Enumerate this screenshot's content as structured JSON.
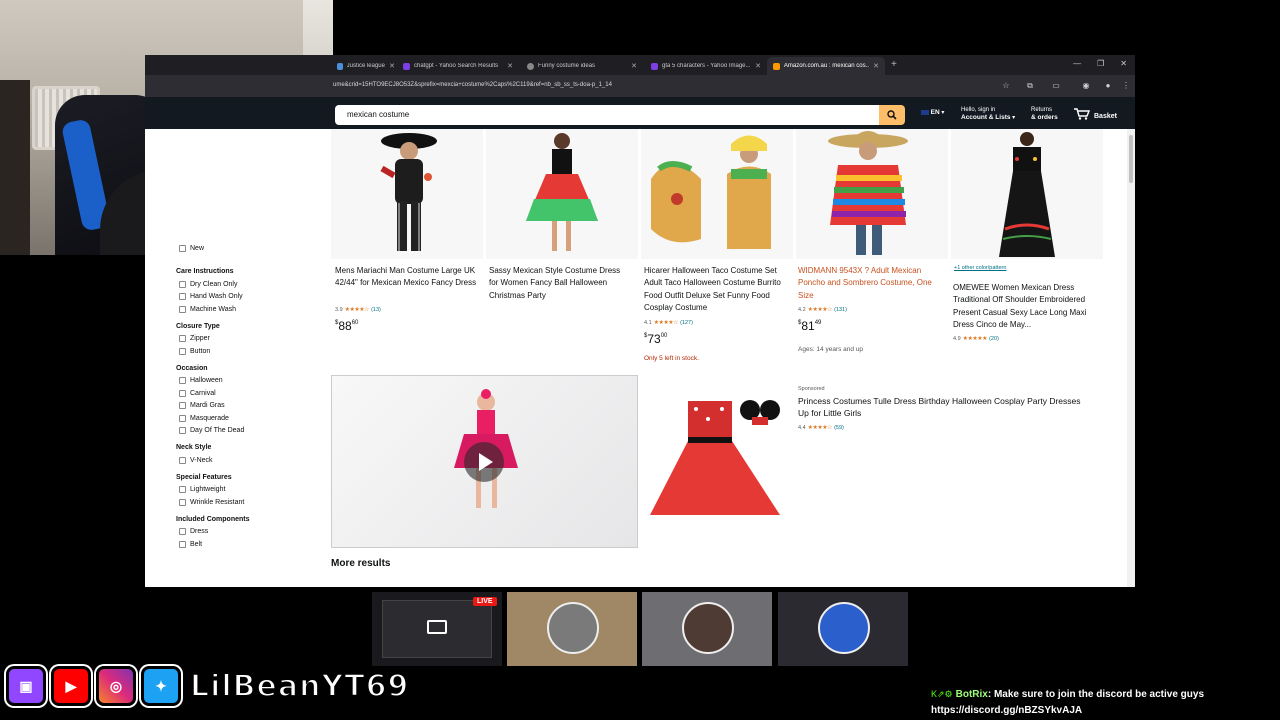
{
  "browser": {
    "tabs": [
      {
        "label": "Justice league c...",
        "favicon_color": "#4a90d9",
        "active": false
      },
      {
        "label": "chatgpt - Yahoo Search Results",
        "favicon_color": "#7b3fe4",
        "active": false
      },
      {
        "label": "Funny costume ideas",
        "favicon_color": "#888888",
        "active": false
      },
      {
        "label": "gta 5 characters - Yahoo Image...",
        "favicon_color": "#7b3fe4",
        "active": false
      },
      {
        "label": "Amazon.com.au : mexican cos...",
        "favicon_color": "#ff9900",
        "active": true
      }
    ],
    "url": "ume&crid=15HTO9ECJ8O53Z&sprefix=mexcia+costume%2Caps%2C119&ref=nb_sb_ss_ts-doa-p_1_14"
  },
  "amazon": {
    "search_value": "mexican costume",
    "language": "EN",
    "account_line1": "Hello, sign in",
    "account_line2": "Account & Lists",
    "returns_line1": "Returns",
    "returns_line2": "& orders",
    "basket_label": "Basket",
    "basket_count": "0",
    "accent": "#febd69"
  },
  "sidebar": {
    "partial_item": "New",
    "groups": [
      {
        "heading": "Care Instructions",
        "options": [
          "Dry Clean Only",
          "Hand Wash Only",
          "Machine Wash"
        ]
      },
      {
        "heading": "Closure Type",
        "options": [
          "Zipper",
          "Button"
        ]
      },
      {
        "heading": "Occasion",
        "options": [
          "Halloween",
          "Carnival",
          "Mardi Gras",
          "Masquerade",
          "Day Of The Dead"
        ]
      },
      {
        "heading": "Neck Style",
        "options": [
          "V-Neck"
        ]
      },
      {
        "heading": "Special Features",
        "options": [
          "Lightweight",
          "Wrinkle Resistant"
        ]
      },
      {
        "heading": "Included Components",
        "options": [
          "Dress",
          "Belt"
        ]
      }
    ]
  },
  "products": [
    {
      "title": "Mens Mariachi Man Costume Large UK 42/44\" for Mexican Mexico Fancy Dress",
      "rating": "3.9",
      "stars": "★★★★☆",
      "reviews": "(13)",
      "price_whole": "88",
      "price_frac": "60"
    },
    {
      "title": "Sassy Mexican Style Costume Dress for Women Fancy Ball Halloween Christmas Party",
      "rating": "",
      "stars": "",
      "reviews": "",
      "price_whole": "",
      "price_frac": ""
    },
    {
      "title": "Hicarer Halloween Taco Costume Set Adult Taco Halloween Costume Burrito Food Outfit Deluxe Set Funny Food Cosplay Costume",
      "rating": "4.1",
      "stars": "★★★★☆",
      "reviews": "(127)",
      "price_whole": "73",
      "price_frac": "00",
      "stock": "Only 5 left in stock."
    },
    {
      "title": "WIDMANN 9543X ? Adult Mexican Poncho and Sombrero Costume, One Size",
      "rating": "4.2",
      "stars": "★★★★☆",
      "reviews": "(131)",
      "price_whole": "81",
      "price_frac": "49",
      "note": "Ages: 14 years and up"
    },
    {
      "title": "OMEWEE Women Mexican Dress Traditional Off Shoulder Embroidered Present Casual Sexy Lace Long Maxi Dress Cinco de May...",
      "rating": "4.9",
      "stars": "★★★★★",
      "reviews": "(20)",
      "price_whole": "",
      "price_frac": "",
      "color_link": "+1 other color/pattern"
    }
  ],
  "sponsored": {
    "label": "Sponsored",
    "title": "Princess Costumes Tulle Dress Birthday Halloween Cosplay Party Dresses Up for Little Girls",
    "rating": "4.4",
    "stars": "★★★★☆",
    "reviews": "(59)"
  },
  "more_results": "More results",
  "overlay": {
    "live_badge": "LIVE",
    "handle": "LilBeanYT69",
    "social_icons": [
      "twitch-icon",
      "youtube-icon",
      "instagram-icon",
      "twitter-icon"
    ],
    "chat_user": "BotRix",
    "chat_message": ": Make sure to join the discord be active guys",
    "chat_link": "https://discord.gg/nBZSYkvAJA"
  }
}
